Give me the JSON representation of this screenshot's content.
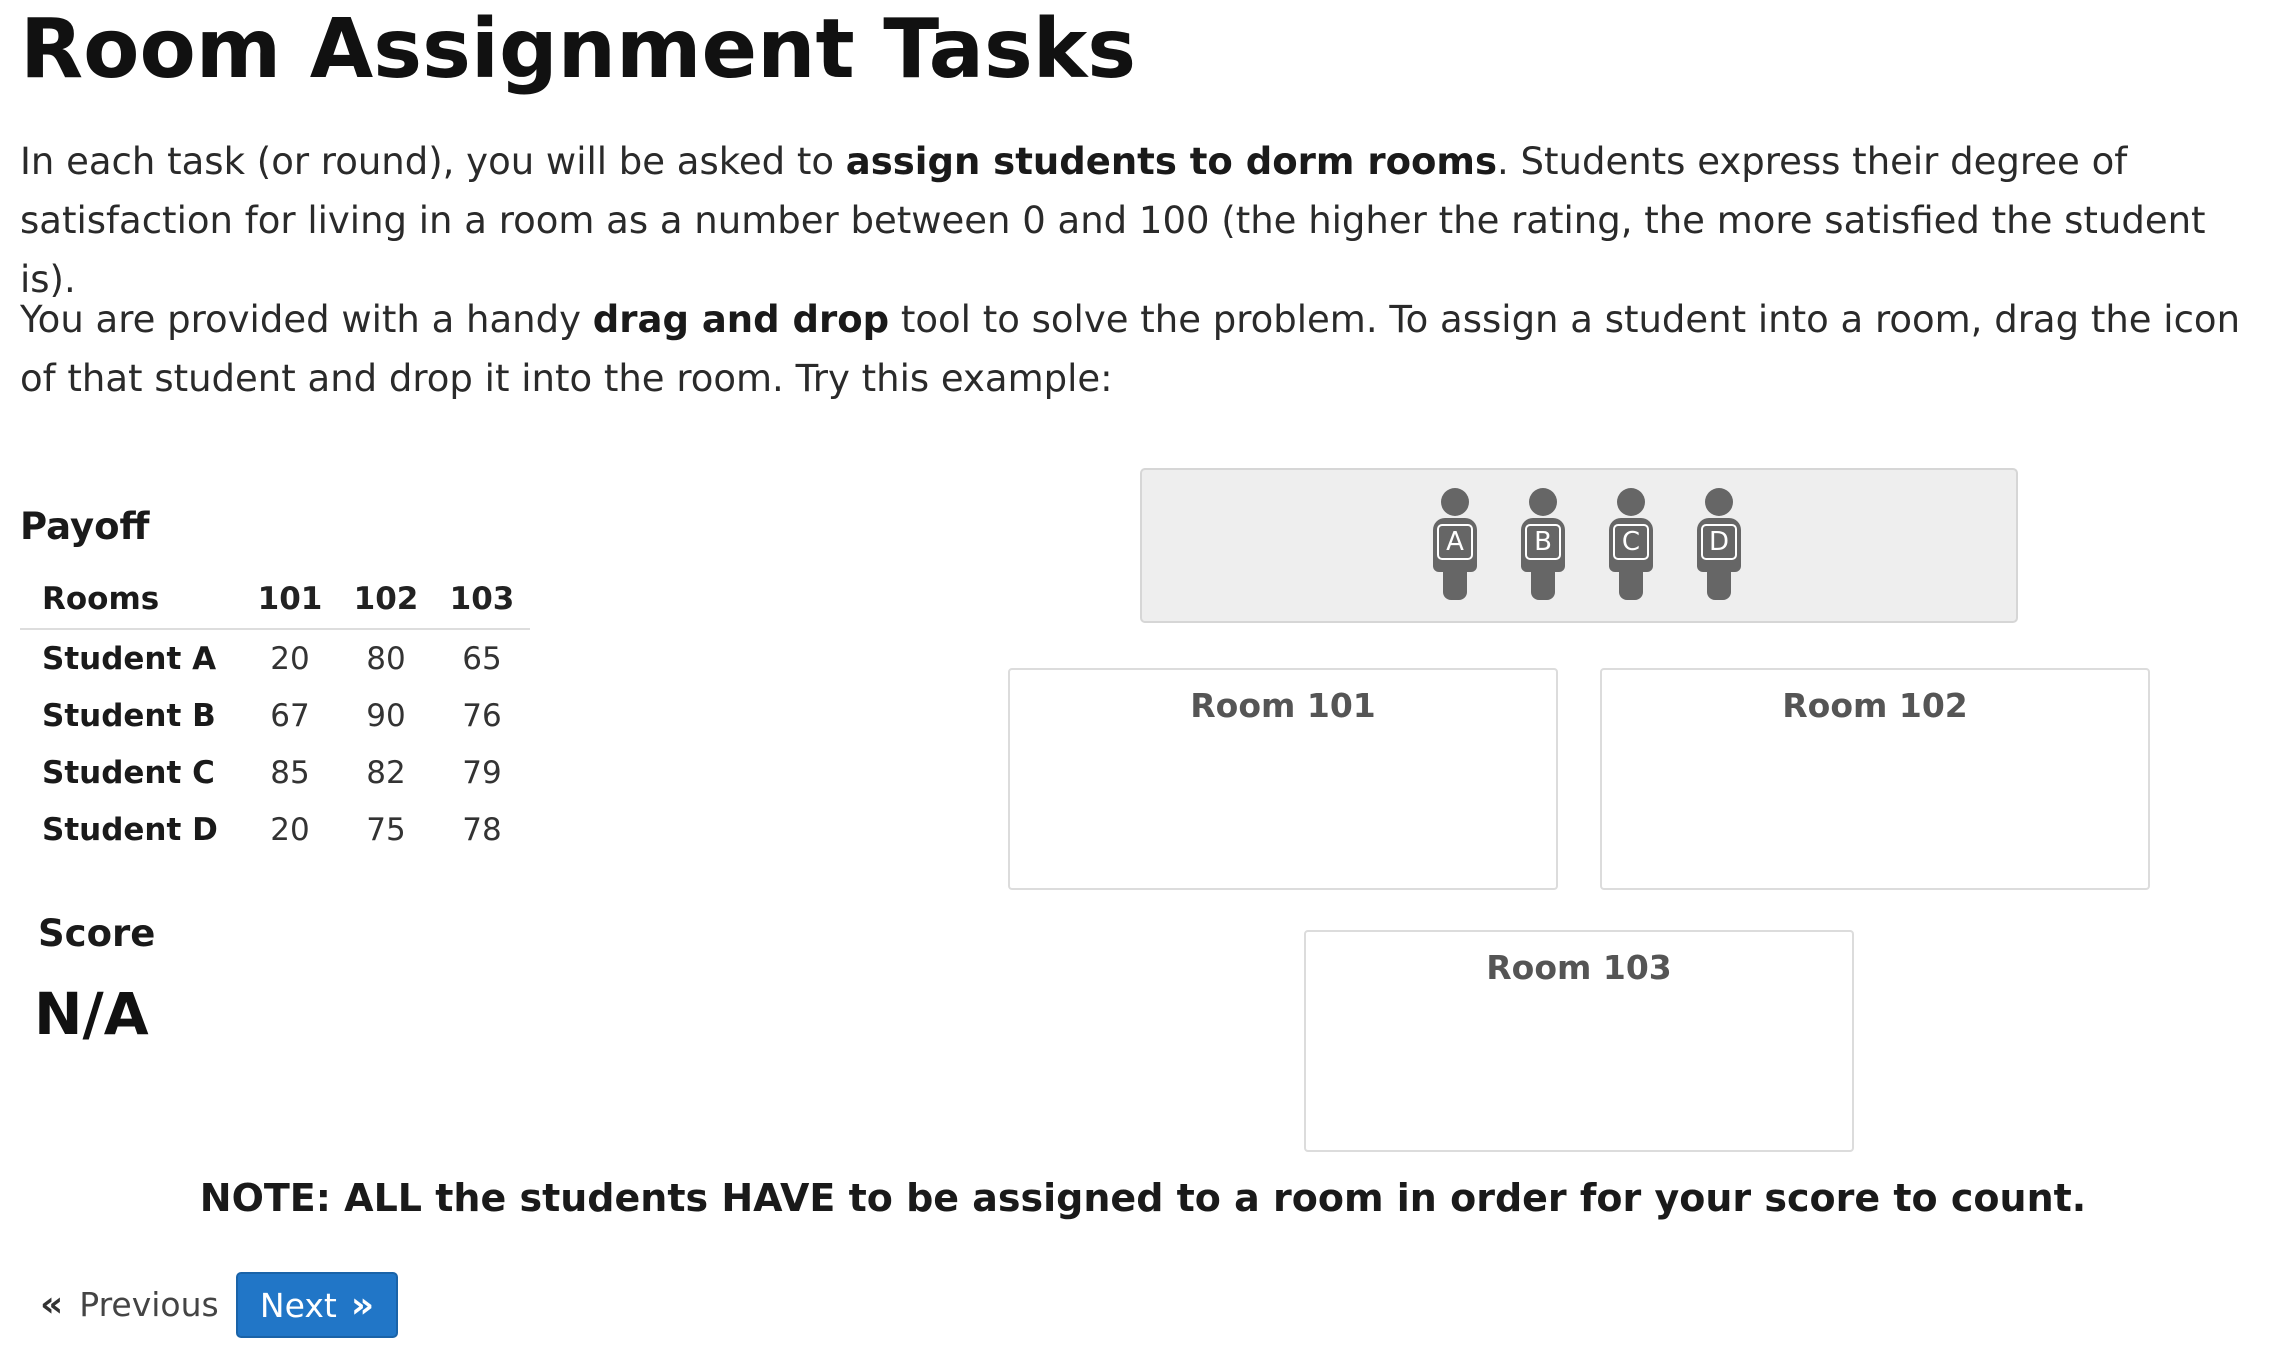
{
  "page": {
    "title": "Room Assignment Tasks",
    "intro": {
      "p1_pre": "In each task (or round), you will be asked to ",
      "p1_bold": "assign students to dorm rooms",
      "p1_post": ". Students express their degree of satisfaction for living in a room as a number between 0 and 100 (the higher the rating, the more satisfied the student is).",
      "p2_pre": "You are provided with a handy ",
      "p2_bold": "drag and drop",
      "p2_post": " tool to solve the problem. To assign a student into a room, drag the icon of that student and drop it into the room. Try this example:"
    }
  },
  "payoff": {
    "title": "Payoff",
    "header": [
      "Rooms",
      "101",
      "102",
      "103"
    ],
    "rows": [
      {
        "name": "Student A",
        "values": [
          "20",
          "80",
          "65"
        ]
      },
      {
        "name": "Student B",
        "values": [
          "67",
          "90",
          "76"
        ]
      },
      {
        "name": "Student C",
        "values": [
          "85",
          "82",
          "79"
        ]
      },
      {
        "name": "Student D",
        "values": [
          "20",
          "75",
          "78"
        ]
      }
    ]
  },
  "score": {
    "title": "Score",
    "value": "N/A"
  },
  "students": [
    {
      "letter": "A",
      "icon": "person-icon"
    },
    {
      "letter": "B",
      "icon": "person-icon"
    },
    {
      "letter": "C",
      "icon": "person-icon"
    },
    {
      "letter": "D",
      "icon": "person-icon"
    }
  ],
  "rooms": [
    {
      "label": "Room 101"
    },
    {
      "label": "Room 102"
    },
    {
      "label": "Room 103"
    }
  ],
  "note": "NOTE: ALL the students HAVE to be assigned to a room in order for your score to count.",
  "nav": {
    "previous_label": "Previous",
    "previous_icon": "double-chevron-left-icon",
    "next_label": "Next",
    "next_icon": "double-chevron-right-icon"
  },
  "colors": {
    "accent": "#2176c7",
    "student_icon": "#666666",
    "tray_background": "#eeeeee"
  }
}
